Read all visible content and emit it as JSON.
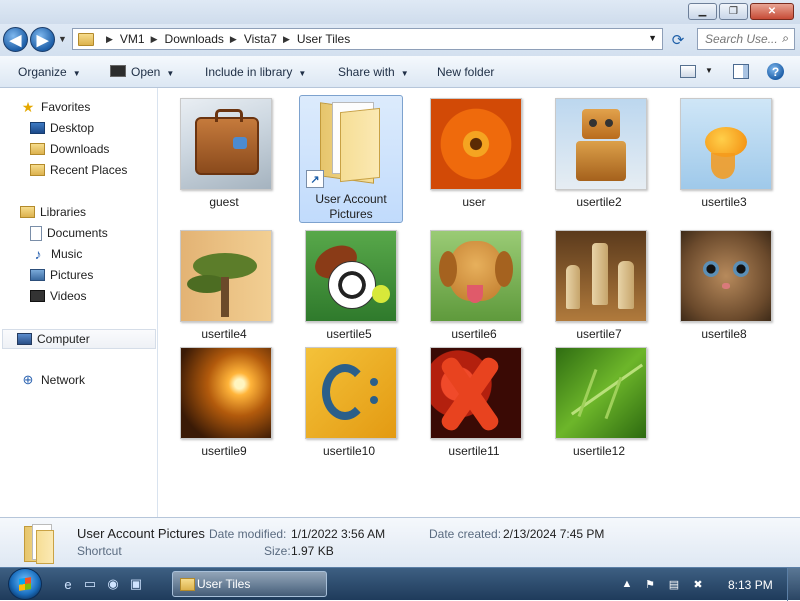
{
  "window": {
    "minimize": "▁",
    "maximize": "❐",
    "close": "✕"
  },
  "address": {
    "breadcrumbs": [
      "VM1",
      "Downloads",
      "Vista7",
      "User Tiles"
    ],
    "search_placeholder": "Search Use..."
  },
  "toolbar": {
    "organize": "Organize",
    "open": "Open",
    "include_in_library": "Include in library",
    "share_with": "Share with",
    "new_folder": "New folder"
  },
  "nav": {
    "favorites": "Favorites",
    "desktop": "Desktop",
    "downloads": "Downloads",
    "recent_places": "Recent Places",
    "libraries": "Libraries",
    "documents": "Documents",
    "music": "Music",
    "pictures": "Pictures",
    "videos": "Videos",
    "computer": "Computer",
    "network": "Network"
  },
  "files": [
    {
      "name": "guest"
    },
    {
      "name": "User Account Pictures",
      "selected": true
    },
    {
      "name": "user"
    },
    {
      "name": "usertile2"
    },
    {
      "name": "usertile3"
    },
    {
      "name": "usertile4"
    },
    {
      "name": "usertile5"
    },
    {
      "name": "usertile6"
    },
    {
      "name": "usertile7"
    },
    {
      "name": "usertile8"
    },
    {
      "name": "usertile9"
    },
    {
      "name": "usertile10"
    },
    {
      "name": "usertile11"
    },
    {
      "name": "usertile12"
    }
  ],
  "details": {
    "name": "User Account Pictures",
    "type": "Shortcut",
    "date_modified_label": "Date modified:",
    "date_modified": "1/1/2022 3:56 AM",
    "date_created_label": "Date created:",
    "date_created": "2/13/2024 7:45 PM",
    "size_label": "Size:",
    "size": "1.97 KB"
  },
  "taskbar": {
    "active_task": "User Tiles",
    "clock": "8:13 PM"
  }
}
